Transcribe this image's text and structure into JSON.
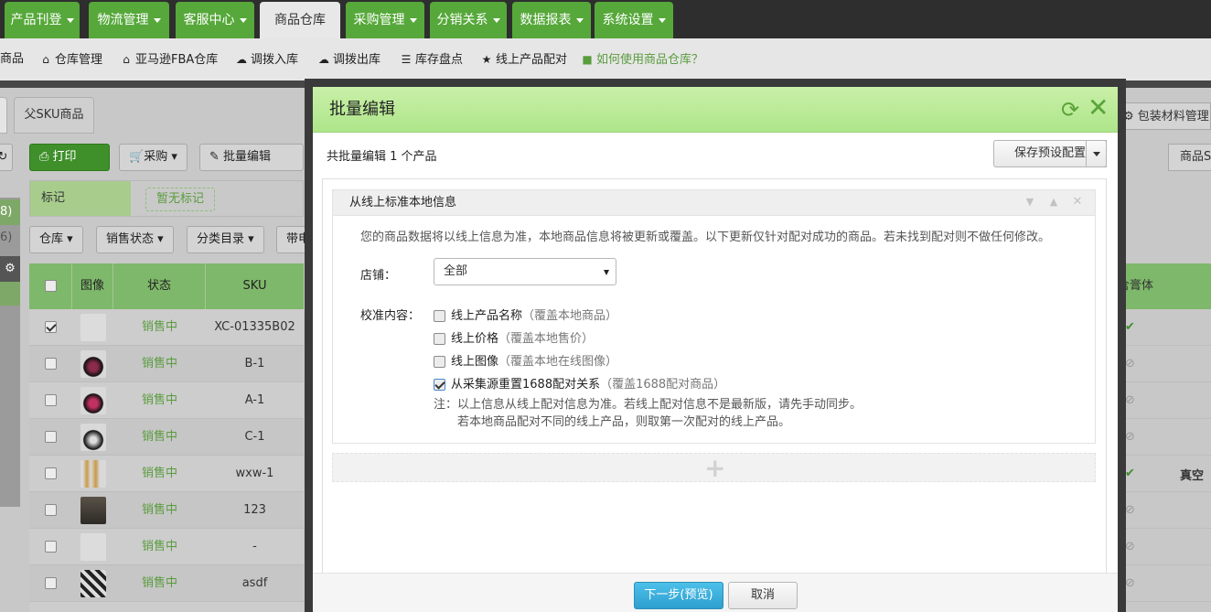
{
  "nav": {
    "tabs": [
      {
        "label": "产品刊登"
      },
      {
        "label": "物流管理"
      },
      {
        "label": "客服中心"
      },
      {
        "label": "商品仓库"
      },
      {
        "label": "采购管理"
      },
      {
        "label": "分销关系"
      },
      {
        "label": "数据报表"
      },
      {
        "label": "系统设置"
      }
    ],
    "active_tab": "商品仓库"
  },
  "subbar": {
    "items": [
      {
        "label": "商品",
        "icon": "none"
      },
      {
        "label": "仓库管理",
        "icon": "home-icon"
      },
      {
        "label": "亚马逊FBA仓库",
        "icon": "home-icon"
      },
      {
        "label": "调拨入库",
        "icon": "cloud-download-icon"
      },
      {
        "label": "调拨出库",
        "icon": "cloud-upload-icon"
      },
      {
        "label": "库存盘点",
        "icon": "list-icon"
      },
      {
        "label": "线上产品配对",
        "icon": "star-icon"
      }
    ],
    "help": "如何使用商品仓库？"
  },
  "background": {
    "tab_parent_sku": "父SKU商品",
    "btn_print": "打印",
    "btn_purchase": "采购",
    "btn_batch_edit": "批量编辑",
    "mark_label": "标记",
    "mark_none": "暂无标记",
    "side_counts": [
      "8)",
      "6)"
    ],
    "filters": [
      "仓库",
      "销售状态",
      "分类目录",
      "带电"
    ],
    "table_headers": [
      "图像",
      "状态",
      "SKU"
    ],
    "rows": [
      {
        "checked": true,
        "status": "销售中",
        "sku": "XC-01335B02"
      },
      {
        "checked": false,
        "status": "销售中",
        "sku": "B-1"
      },
      {
        "checked": false,
        "status": "销售中",
        "sku": "A-1"
      },
      {
        "checked": false,
        "status": "销售中",
        "sku": "C-1"
      },
      {
        "checked": false,
        "status": "销售中",
        "sku": "wxw-1"
      },
      {
        "checked": false,
        "status": "销售中",
        "sku": "123"
      },
      {
        "checked": false,
        "status": "销售中",
        "sku": "-"
      },
      {
        "checked": false,
        "status": "销售中",
        "sku": "asdf"
      }
    ],
    "right_btn_packaging": "包装材料管理",
    "right_btn_sku": "商品S",
    "right_header": "含膏体",
    "right_extra": "真空"
  },
  "modal": {
    "title": "批量编辑",
    "summary": "共批量编辑 1 个产品",
    "preset_button": "保存预设配置",
    "panel_title": "从线上标准本地信息",
    "description": "您的商品数据将以线上信息为准，本地商品信息将被更新或覆盖。以下更新仅针对配对成功的商品。若未找到配对则不做任何修改。",
    "shop_label": "店铺：",
    "shop_value": "全部",
    "calibrate_label": "校准内容：",
    "options": [
      {
        "label": "线上产品名称",
        "hint": "（覆盖本地商品）",
        "checked": false
      },
      {
        "label": "线上价格",
        "hint": "（覆盖本地售价）",
        "checked": false
      },
      {
        "label": "线上图像",
        "hint": "（覆盖本地在线图像）",
        "checked": false
      },
      {
        "label": "从采集源重置1688配对关系",
        "hint": "（覆盖1688配对商品）",
        "checked": true
      }
    ],
    "note_line1": "注：以上信息从线上配对信息为准。若线上配对信息不是最新版，请先手动同步。",
    "note_line2": "若本地商品配对不同的线上产品，则取第一次配对的线上产品。",
    "btn_next": "下一步(预览)",
    "btn_cancel": "取消"
  },
  "colors": {
    "nav_green": "#56a83a",
    "header_green": "#aee58a",
    "primary_blue": "#2e9fcf"
  }
}
